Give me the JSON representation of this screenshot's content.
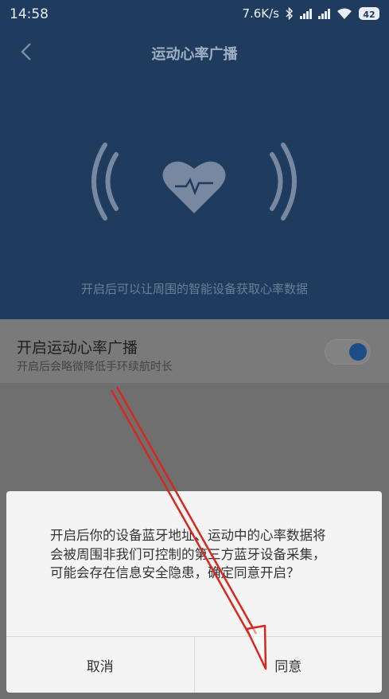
{
  "status": {
    "time": "14:58",
    "speed": "7.6K/s",
    "battery": "42"
  },
  "header": {
    "title": "运动心率广播"
  },
  "hero": {
    "description": "开启后可以让周围的智能设备获取心率数据"
  },
  "setting": {
    "title": "开启运动心率广播",
    "subtitle": "开启后会略微降低手环续航时长",
    "enabled": true
  },
  "dialog": {
    "message": "开启后你的设备蓝牙地址、运动中的心率数据将会被周围非我们可控制的第三方蓝牙设备采集，可能会存在信息安全隐患，确定同意开启？",
    "cancel_label": "取消",
    "agree_label": "同意"
  },
  "colors": {
    "header_bg": "#1f3c5e",
    "accent": "#1c4d86",
    "annotation": "#d8281e"
  }
}
